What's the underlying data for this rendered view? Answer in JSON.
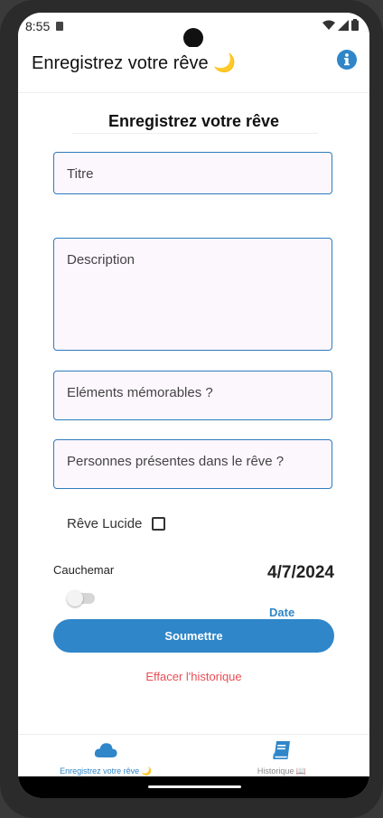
{
  "status_bar": {
    "time": "8:55"
  },
  "header": {
    "title": "Enregistrez votre rêve 🌙",
    "info_icon": "info-icon"
  },
  "form": {
    "title": "Enregistrez votre rêve",
    "fields": {
      "title_placeholder": "Titre",
      "description_placeholder": "Description",
      "memorable_placeholder": "Eléments mémorables ?",
      "people_placeholder": "Personnes présentes dans le rêve ?"
    },
    "lucid_label": "Rêve Lucide",
    "lucid_checked": false,
    "nightmare_label": "Cauchemar",
    "nightmare_on": false,
    "date_value": "4/7/2024",
    "date_button": "Date",
    "submit_label": "Soumettre",
    "clear_history_label": "Effacer l'historique"
  },
  "tabs": [
    {
      "label": "Enregistrez votre rêve 🌙",
      "icon": "cloud-icon",
      "active": true
    },
    {
      "label": "Historique 📖",
      "icon": "book-icon",
      "active": false
    }
  ],
  "colors": {
    "accent": "#2f86c9",
    "field_border": "#2f7bbd",
    "field_bg": "#fcf6fd",
    "danger": "#e94e55",
    "inactive_tab": "#8a8a8a"
  }
}
